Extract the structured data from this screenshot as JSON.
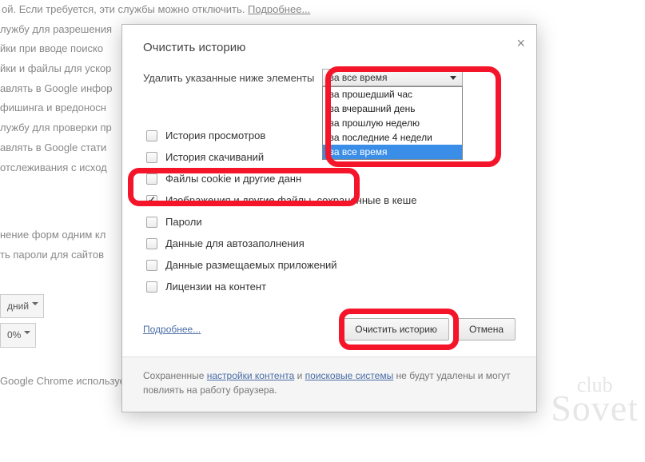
{
  "background": {
    "lines": [
      "ой. Если требуется, эти службы можно отключить.",
      "лужбу для разрешения",
      "йки при вводе поиско",
      "йки и файлы для ускор",
      "авлять в Google инфор",
      "фишинга и вредоносн",
      "лужбу для проверки пр",
      "авлять в Google стати",
      "отслеживания с исход",
      "нение форм одним кл",
      "ть пароли для сайтов"
    ],
    "topLink": "Подробнее...",
    "bottomSelects": [
      "дний",
      "0%"
    ],
    "bottomLine": "Google Chrome использует системные настройки прокси-сервера."
  },
  "dialog": {
    "title": "Очистить историю",
    "deleteLabel": "Удалить указанные ниже элементы",
    "timeRanges": {
      "selected": "за все время",
      "options": [
        "за прошедший час",
        "за вчерашний день",
        "за прошлую неделю",
        "за последние 4 недели",
        "за все время"
      ]
    },
    "checkboxes": [
      {
        "label": "История просмотров",
        "checked": false
      },
      {
        "label": "История скачиваний",
        "checked": false
      },
      {
        "label": "Файлы cookie и другие данн",
        "checked": false
      },
      {
        "label": "Изображения и другие файлы, сохраненные в кеше",
        "checked": true
      },
      {
        "label": "Пароли",
        "checked": false
      },
      {
        "label": "Данные для автозаполнения",
        "checked": false
      },
      {
        "label": "Данные размещаемых приложений",
        "checked": false
      },
      {
        "label": "Лицензии на контент",
        "checked": false
      }
    ],
    "learnMore": "Подробнее...",
    "clearButton": "Очистить историю",
    "cancelButton": "Отмена",
    "footerPrefix": "Сохраненные ",
    "footerLink1": "настройки контента",
    "footerMid": " и ",
    "footerLink2": "поисковые системы",
    "footerSuffix": " не будут удалены и могут повлиять на работу браузера."
  },
  "watermark": {
    "top": "club",
    "bottom": "Sovet"
  }
}
